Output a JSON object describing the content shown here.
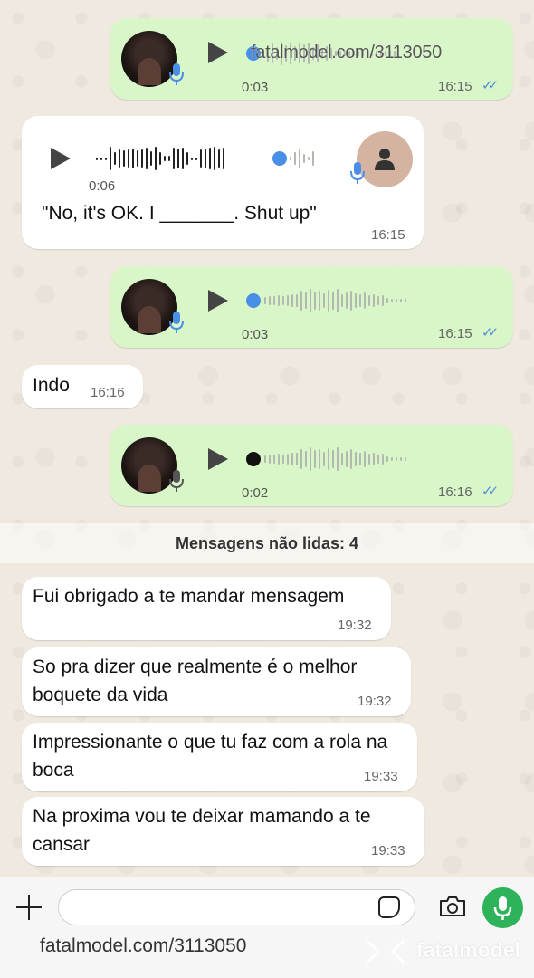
{
  "messages": [
    {
      "type": "voice",
      "direction": "outgoing",
      "duration": "0:03",
      "time": "16:15",
      "status": "read"
    },
    {
      "type": "voice",
      "direction": "incoming",
      "duration": "0:06",
      "caption": "\"No, it's OK. I _______. Shut up\"",
      "time": "16:15"
    },
    {
      "type": "voice",
      "direction": "outgoing",
      "duration": "0:03",
      "time": "16:15",
      "status": "read"
    },
    {
      "type": "text",
      "direction": "incoming",
      "text": "Indo",
      "time": "16:16"
    },
    {
      "type": "voice",
      "direction": "outgoing",
      "duration": "0:02",
      "time": "16:16",
      "status": "read"
    },
    {
      "type": "text",
      "direction": "incoming",
      "text": "Fui obrigado a te mandar mensagem",
      "time": "19:32"
    },
    {
      "type": "text",
      "direction": "incoming",
      "text": "So pra dizer que realmente é o melhor boquete da vida",
      "time": "19:32"
    },
    {
      "type": "text",
      "direction": "incoming",
      "text": "Impressionante o que tu faz com a rola na boca",
      "time": "19:33"
    },
    {
      "type": "text",
      "direction": "incoming",
      "text": "Na proxima vou te deixar mamando a te cansar",
      "time": "19:33"
    }
  ],
  "unread_label": "Mensagens não lidas: 4",
  "composer": {
    "value": "",
    "placeholder": ""
  },
  "watermark": {
    "url": "fatalmodel.com/3113050",
    "brand": "fatalmodel"
  },
  "colors": {
    "outgoing": "#d8f6c7",
    "incoming": "#ffffff",
    "accent": "#2eb35b",
    "read_ticks": "#4e8fd9"
  },
  "icons": [
    "plus-icon",
    "sticker-icon",
    "camera-icon",
    "microphone-icon",
    "play-icon",
    "contact-avatar-icon"
  ]
}
